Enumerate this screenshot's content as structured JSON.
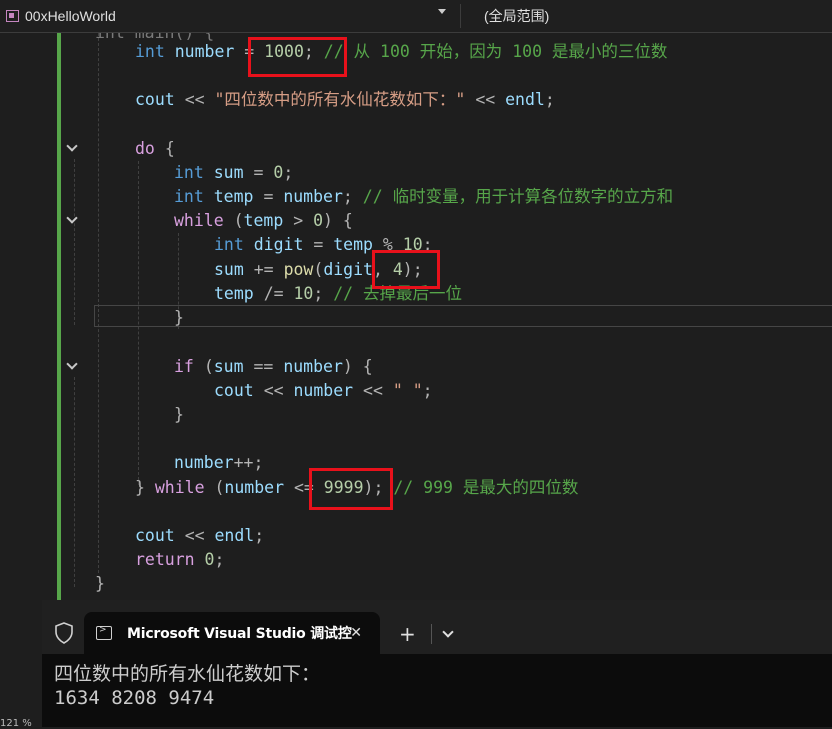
{
  "navbar": {
    "project": "00xHelloWorld",
    "scope": "(全局范围)"
  },
  "code": {
    "line_partial": "int main() {",
    "l1_type": "int",
    "l1_var": "number",
    "l1_val": "1000",
    "l1_comment": "// 从 100 开始，因为 100 是最小的三位数",
    "l2_cout": "cout",
    "l2_str": "\"四位数中的所有水仙花数如下：\"",
    "l2_endl": "endl",
    "l3_do": "do",
    "l4_type": "int",
    "l4_var": "sum",
    "l4_val": "0",
    "l5_type": "int",
    "l5_var": "temp",
    "l5_rhs": "number",
    "l5_comment": "// 临时变量，用于计算各位数字的立方和",
    "l6_while": "while",
    "l6_var": "temp",
    "l6_val": "0",
    "l7_type": "int",
    "l7_var": "digit",
    "l7_rhs": "temp",
    "l7_val": "10",
    "l8_var": "sum",
    "l8_fn": "pow",
    "l8_arg": "digit",
    "l8_exp": "4",
    "l9_var": "temp",
    "l9_val": "10",
    "l9_comment": "// 去掉最后一位",
    "l10_if": "if",
    "l10_a": "sum",
    "l10_b": "number",
    "l11_cout": "cout",
    "l11_var": "number",
    "l11_str": "\" \"",
    "l12_var": "number",
    "l13_while": "while",
    "l13_var": "number",
    "l13_val": "9999",
    "l13_comment": "// 999 是最大的四位数",
    "l14_cout": "cout",
    "l14_endl": "endl",
    "l15_return": "return",
    "l15_val": "0"
  },
  "console": {
    "tab_title": "Microsoft Visual Studio 调试控",
    "close": "✕",
    "new_tab": "+",
    "output_line1": "四位数中的所有水仙花数如下：",
    "output_line2": "1634 8208 9474"
  },
  "status": {
    "zoom": "121 %"
  },
  "icons": [
    "project-icon",
    "dropdown-caret-icon",
    "fold-chevron-icon",
    "shield-icon",
    "terminal-icon",
    "close-icon",
    "plus-icon",
    "chevron-down-icon"
  ],
  "colors": {
    "keyword": "#569cd6",
    "control": "#d8a0df",
    "identifier": "#9cdcfe",
    "number": "#b5cea8",
    "string": "#d69d85",
    "comment": "#57a64a",
    "function": "#dcdcaa",
    "highlight_box": "#e8111b"
  }
}
